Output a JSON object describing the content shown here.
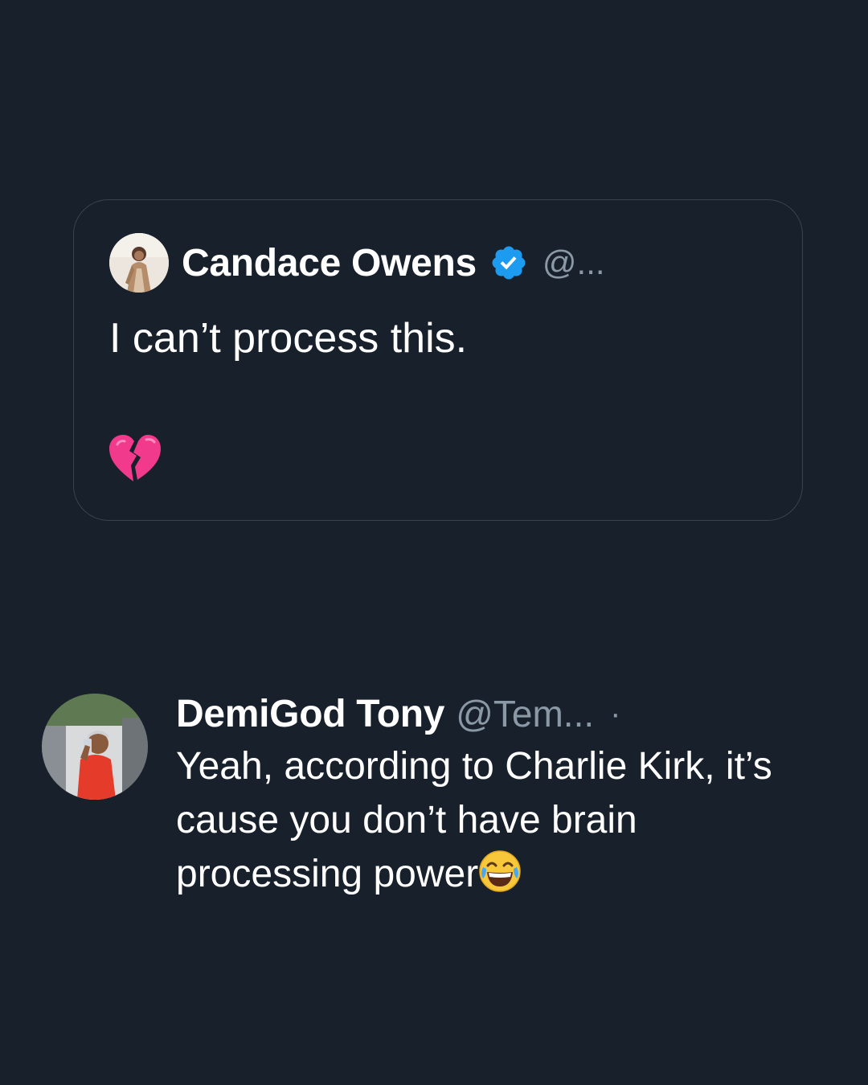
{
  "colors": {
    "background": "#17202b",
    "card_border": "#38444d",
    "text_primary": "#ffffff",
    "text_secondary": "#8b98a5",
    "verified_blue": "#1d9bf0",
    "heart_pink": "#f23a8c"
  },
  "quoted_tweet": {
    "author_name": "Candace Owens",
    "handle": "@...",
    "verified_icon": "verified-badge-icon",
    "text": "I can’t process this.",
    "emoji": "broken-heart-icon"
  },
  "reply_tweet": {
    "author_name": "DemiGod Tony",
    "handle": "@Tem...",
    "separator": "·",
    "text_line1": "Yeah, according to Charlie Kirk, it’s",
    "text_line2": "cause you don’t have brain",
    "text_line3": "processing power",
    "emoji": "face-with-tears-of-joy-icon"
  }
}
